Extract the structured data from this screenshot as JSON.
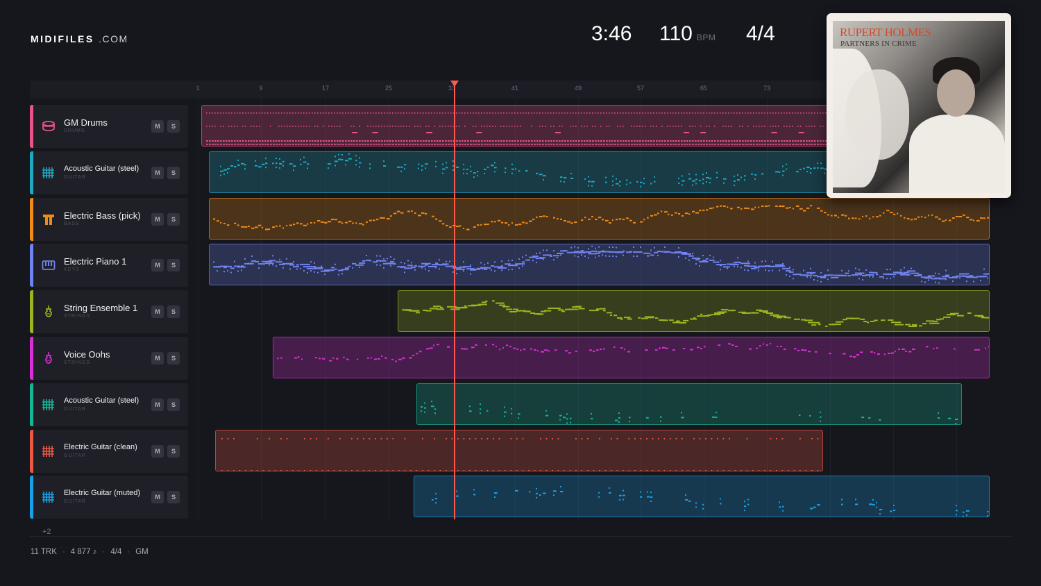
{
  "brand": {
    "name_bold": "MIDIFILES",
    "name_rest": ".COM"
  },
  "stats": {
    "duration": "3:46",
    "tempo": "110",
    "tempo_unit": "BPM",
    "time_signature": "4/4"
  },
  "ruler": {
    "bars": [
      "1",
      "9",
      "17",
      "25",
      "33",
      "41",
      "49",
      "57",
      "65",
      "73"
    ]
  },
  "tracks": [
    {
      "name": "GM Drums",
      "category": "DRUMS",
      "color": "#e8538a",
      "icon": "drum-icon",
      "mute": "M",
      "solo": "S"
    },
    {
      "name": "Acoustic Guitar (steel)",
      "category": "GUITAR",
      "color": "#1fa8be",
      "icon": "guitar-fretboard-icon",
      "mute": "M",
      "solo": "S"
    },
    {
      "name": "Electric Bass (pick)",
      "category": "BASS",
      "color": "#f08a18",
      "icon": "bass-icon",
      "mute": "M",
      "solo": "S"
    },
    {
      "name": "Electric Piano 1",
      "category": "KEYS",
      "color": "#6f82ee",
      "icon": "piano-keys-icon",
      "mute": "M",
      "solo": "S"
    },
    {
      "name": "String Ensemble 1",
      "category": "STRINGS",
      "color": "#99b51f",
      "icon": "violin-icon",
      "mute": "M",
      "solo": "S"
    },
    {
      "name": "Voice Oohs",
      "category": "STRINGS",
      "color": "#d92fd6",
      "icon": "violin-icon",
      "mute": "M",
      "solo": "S"
    },
    {
      "name": "Acoustic Guitar (steel)",
      "category": "GUITAR",
      "color": "#17b597",
      "icon": "guitar-fretboard-icon",
      "mute": "M",
      "solo": "S"
    },
    {
      "name": "Electric Guitar (clean)",
      "category": "GUITAR",
      "color": "#ea5846",
      "icon": "guitar-fretboard-icon",
      "mute": "M",
      "solo": "S"
    },
    {
      "name": "Electric Guitar (muted)",
      "category": "GUITAR",
      "color": "#1aa0e8",
      "icon": "guitar-fretboard-icon",
      "mute": "M",
      "solo": "S"
    }
  ],
  "more_tracks": "+2",
  "footer": {
    "tracks": "11 TRK",
    "notes": "4 877 ♪",
    "meter": "4/4",
    "standard": "GM"
  },
  "album": {
    "artist": "RUPERT HOLMES",
    "title": "PARTNERS IN CRIME"
  }
}
